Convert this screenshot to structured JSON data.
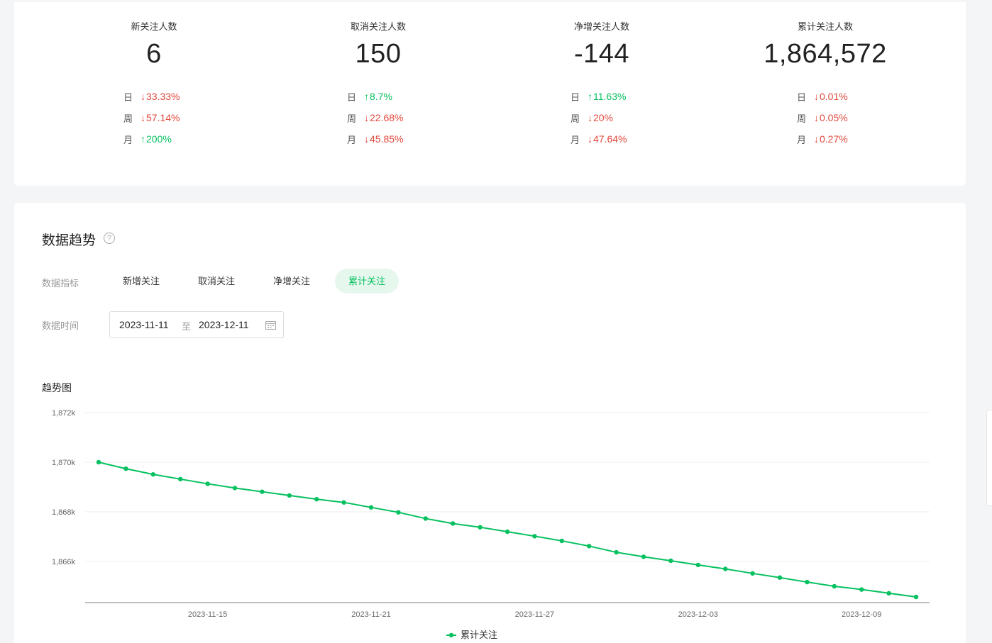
{
  "summary": {
    "stats": [
      {
        "title": "新关注人数",
        "value": "6",
        "rows": [
          {
            "period": "日",
            "dir": "down",
            "arrow": "↓",
            "pct": "33.33%"
          },
          {
            "period": "周",
            "dir": "down",
            "arrow": "↓",
            "pct": "57.14%"
          },
          {
            "period": "月",
            "dir": "up",
            "arrow": "↑",
            "pct": "200%"
          }
        ]
      },
      {
        "title": "取消关注人数",
        "value": "150",
        "rows": [
          {
            "period": "日",
            "dir": "up",
            "arrow": "↑",
            "pct": "8.7%"
          },
          {
            "period": "周",
            "dir": "down",
            "arrow": "↓",
            "pct": "22.68%"
          },
          {
            "period": "月",
            "dir": "down",
            "arrow": "↓",
            "pct": "45.85%"
          }
        ]
      },
      {
        "title": "净增关注人数",
        "value": "-144",
        "rows": [
          {
            "period": "日",
            "dir": "up",
            "arrow": "↑",
            "pct": "11.63%"
          },
          {
            "period": "周",
            "dir": "down",
            "arrow": "↓",
            "pct": "20%"
          },
          {
            "period": "月",
            "dir": "down",
            "arrow": "↓",
            "pct": "47.64%"
          }
        ]
      },
      {
        "title": "累计关注人数",
        "value": "1,864,572",
        "rows": [
          {
            "period": "日",
            "dir": "down",
            "arrow": "↓",
            "pct": "0.01%"
          },
          {
            "period": "周",
            "dir": "down",
            "arrow": "↓",
            "pct": "0.05%"
          },
          {
            "period": "月",
            "dir": "down",
            "arrow": "↓",
            "pct": "0.27%"
          }
        ]
      }
    ]
  },
  "trend": {
    "title": "数据趋势",
    "help_icon": "question-circle-icon",
    "metric_label": "数据指标",
    "metrics": [
      "新增关注",
      "取消关注",
      "净增关注",
      "累计关注"
    ],
    "active_metric": 3,
    "time_label": "数据时间",
    "date_start": "2023-11-11",
    "date_sep": "至",
    "date_end": "2023-12-11",
    "calendar_icon": "calendar-icon",
    "chart_label": "趋势图"
  },
  "colors": {
    "accent": "#07c160",
    "up": "#07c160",
    "down": "#e2493d"
  },
  "chart_data": {
    "type": "line",
    "x": [
      "2023-11-11",
      "2023-11-12",
      "2023-11-13",
      "2023-11-14",
      "2023-11-15",
      "2023-11-16",
      "2023-11-17",
      "2023-11-18",
      "2023-11-19",
      "2023-11-20",
      "2023-11-21",
      "2023-11-22",
      "2023-11-23",
      "2023-11-24",
      "2023-11-25",
      "2023-11-26",
      "2023-11-27",
      "2023-11-28",
      "2023-11-29",
      "2023-11-30",
      "2023-12-01",
      "2023-12-02",
      "2023-12-03",
      "2023-12-04",
      "2023-12-05",
      "2023-12-06",
      "2023-12-07",
      "2023-12-08",
      "2023-12-09",
      "2023-12-10",
      "2023-12-11"
    ],
    "x_ticks": [
      "2023-11-15",
      "2023-11-21",
      "2023-11-27",
      "2023-12-03",
      "2023-12-09"
    ],
    "y_ticks": [
      "1,866k",
      "1,868k",
      "1,870k",
      "1,872k"
    ],
    "ylim": [
      1864400,
      1872000
    ],
    "series": [
      {
        "name": "累计关注",
        "color": "#07c160",
        "values": [
          1870000,
          1869740,
          1869510,
          1869320,
          1869130,
          1868960,
          1868810,
          1868660,
          1868510,
          1868380,
          1868180,
          1867980,
          1867730,
          1867530,
          1867380,
          1867200,
          1867020,
          1866830,
          1866620,
          1866370,
          1866190,
          1866030,
          1865860,
          1865700,
          1865520,
          1865350,
          1865170,
          1865000,
          1864870,
          1864720,
          1864570
        ]
      }
    ]
  }
}
